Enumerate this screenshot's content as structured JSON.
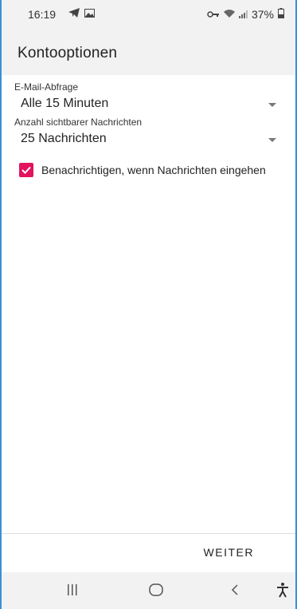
{
  "status_bar": {
    "time": "16:19",
    "battery_percent": "37%",
    "left_icons": [
      "telegram-icon",
      "gallery-icon"
    ],
    "right_icons": [
      "vpn-key-icon",
      "wifi-icon",
      "signal-icon",
      "battery-icon"
    ]
  },
  "app_bar": {
    "title": "Kontooptionen"
  },
  "form": {
    "polling": {
      "label": "E-Mail-Abfrage",
      "value": "Alle 15 Minuten"
    },
    "visible_messages": {
      "label": "Anzahl sichtbarer Nachrichten",
      "value": "25 Nachrichten"
    },
    "notify": {
      "label": "Benachrichtigen, wenn Nachrichten eingehen",
      "checked": true
    }
  },
  "footer": {
    "next_label": "WEITER"
  },
  "nav_bar": {
    "items": [
      "recents-icon",
      "home-icon",
      "back-icon",
      "accessibility-icon"
    ]
  },
  "colors": {
    "accent": "#e2145e",
    "bar_background": "#f2f2f2",
    "frame_border": "#3a8fd6"
  }
}
